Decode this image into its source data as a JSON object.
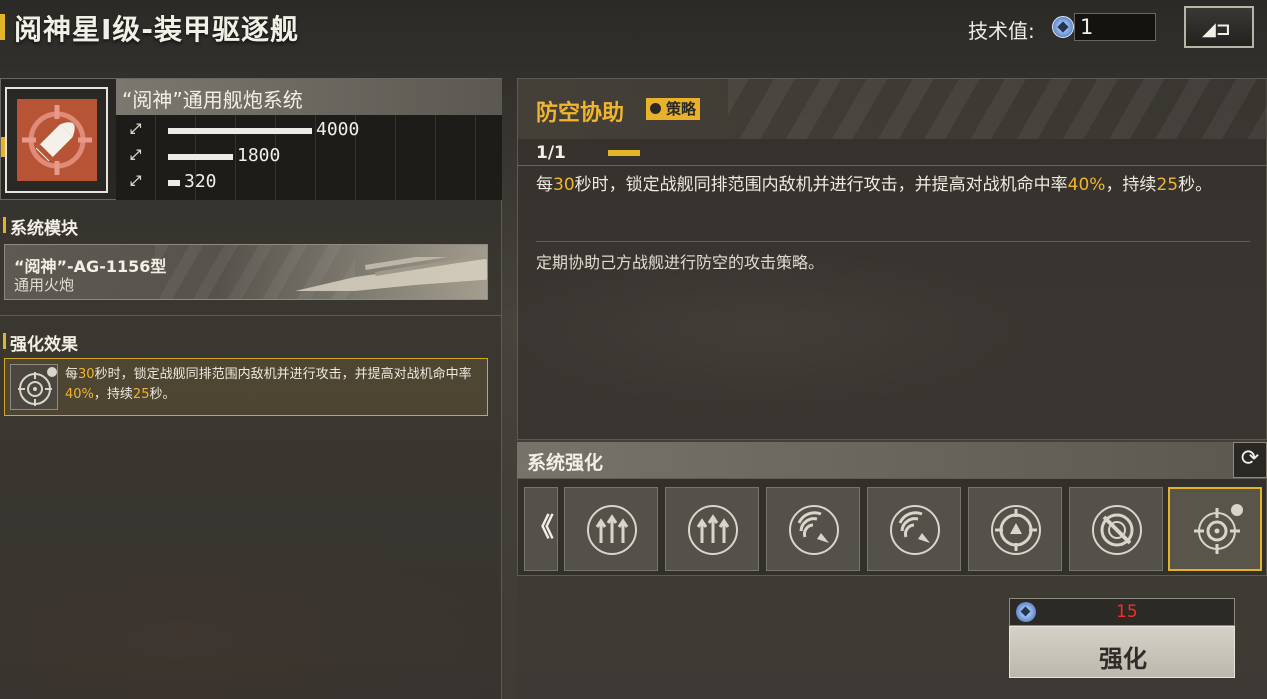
{
  "header": {
    "title": "阅神星I级-装甲驱逐舰",
    "tech_label": "技术值:",
    "tech_value": "1",
    "back_label": "◢⊐"
  },
  "weapon": {
    "name": "“阅神”通用舰炮系统",
    "stats": [
      {
        "icon": "attack-stat-icon",
        "value": "4000",
        "ratio": 1.0
      },
      {
        "icon": "range-stat-icon",
        "value": "1800",
        "ratio": 0.45
      },
      {
        "icon": "speed-stat-icon",
        "value": "320",
        "ratio": 0.08
      }
    ]
  },
  "module_section": {
    "title": "系统模块",
    "name": "“阅神”-AG-1156型",
    "type": "通用火炮"
  },
  "effect_section": {
    "title": "强化效果",
    "text_parts": [
      "每",
      "30",
      "秒时，锁定战舰同排范围内敌机并进行攻击，并提高对战机命中率",
      "40%",
      "，持续",
      "25",
      "秒。"
    ]
  },
  "skill": {
    "name": "防空协助",
    "badge": "策略",
    "level": "1/1",
    "desc_parts": [
      "每",
      "30",
      "秒时，锁定战舰同排范围内敌机并进行攻击，并提高对战机命中率",
      "40%",
      "，持续",
      "25",
      "秒。"
    ],
    "lore": "定期协助己方战舰进行防空的攻击策略。"
  },
  "enhancement": {
    "title": "系统强化",
    "scroll_left": "《",
    "slots": [
      {
        "icon": "triple-arrow-up-icon",
        "selected": false
      },
      {
        "icon": "triple-arrow-up-icon",
        "selected": false
      },
      {
        "icon": "radar-sweep-icon",
        "selected": false
      },
      {
        "icon": "radar-sweep-icon",
        "selected": false
      },
      {
        "icon": "target-triangle-icon",
        "selected": false
      },
      {
        "icon": "target-slash-icon",
        "selected": false
      },
      {
        "icon": "crosshair-strategy-icon",
        "selected": true
      }
    ]
  },
  "enhance": {
    "cost": "15",
    "button_label": "强化"
  },
  "colors": {
    "accent": "#e3b32a",
    "highlight": "#f0b52c",
    "cost_red": "#ff2a1f",
    "weapon_icon_bg": "#b85436"
  }
}
